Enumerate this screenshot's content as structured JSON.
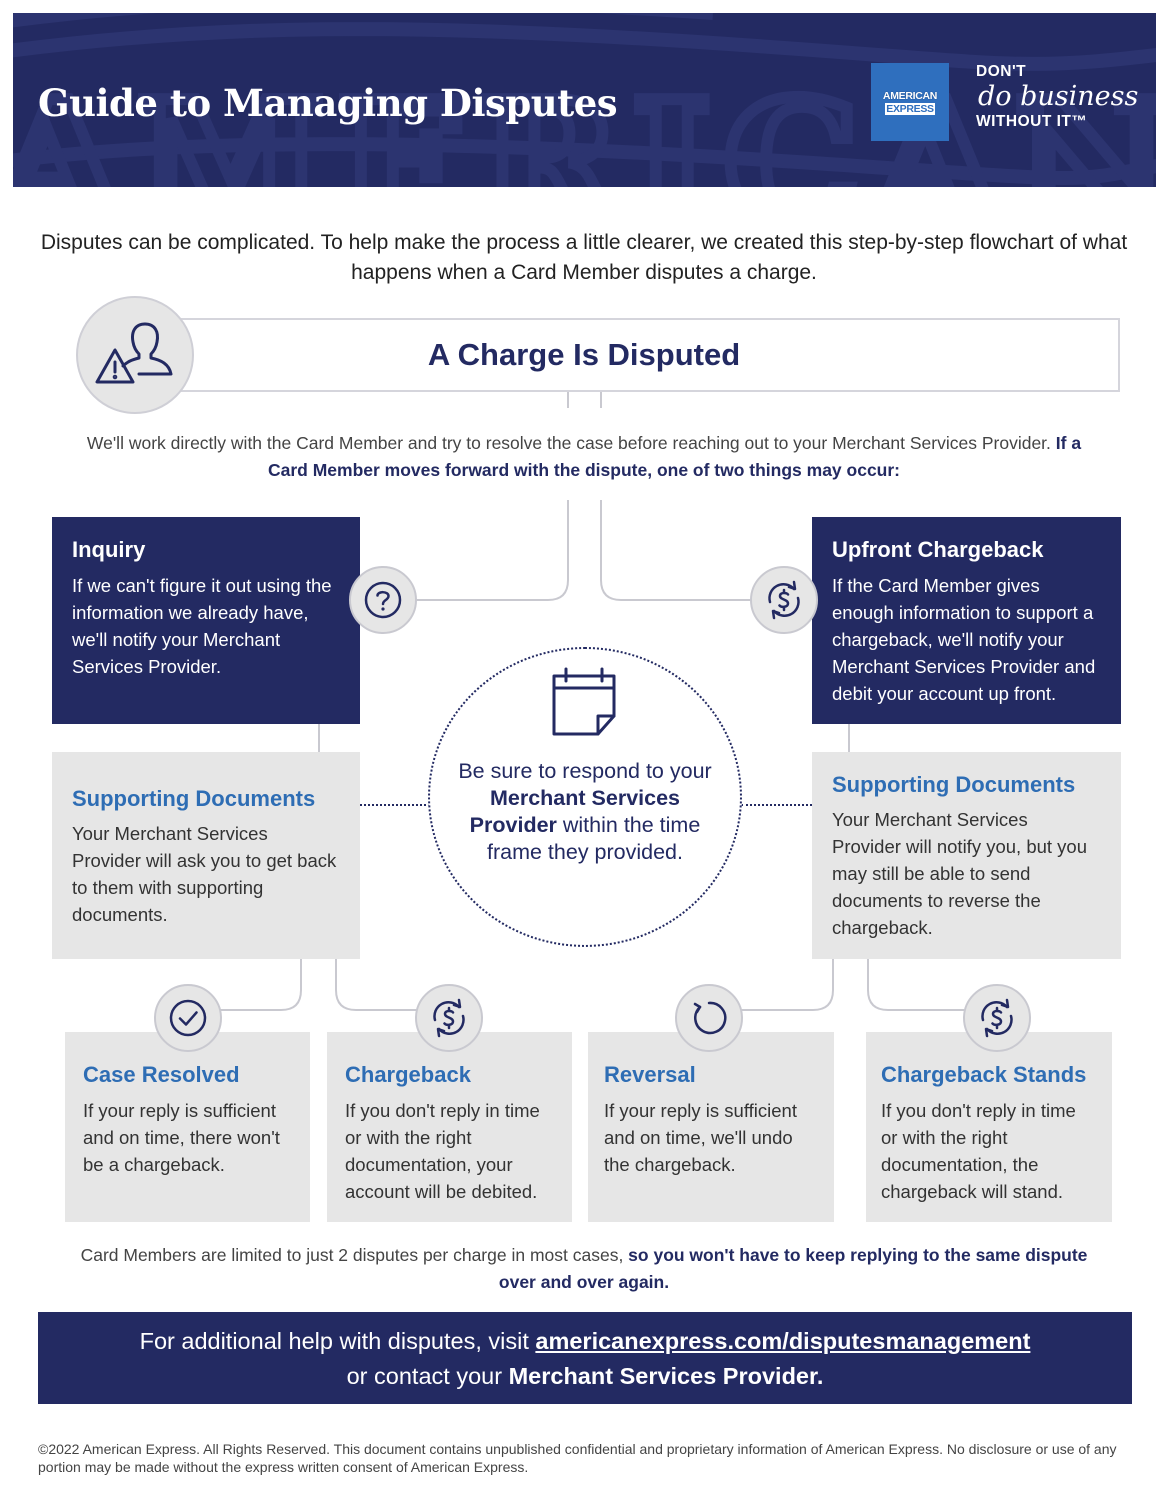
{
  "header": {
    "title": "Guide to Managing Disputes",
    "watermark_text": "AMERICAN EXPRESS",
    "logo": {
      "line1": "AMERICAN",
      "line2": "EXPRESS"
    },
    "tagline": {
      "line1": "DON'T",
      "line2": "do business",
      "line3": "WITHOUT IT™"
    },
    "colors": {
      "navy": "#232a62",
      "amex_blue": "#2f6fbe"
    }
  },
  "intro": "Disputes can be complicated. To help make the process a little clearer, we created this step-by-step flowchart of what happens when a Card Member disputes a charge.",
  "start": {
    "icon": "person-warning-icon",
    "title": "A Charge Is Disputed",
    "desc_plain": "We'll work directly with the Card Member and try to resolve the case before reaching out to your Merchant Services Provider.",
    "desc_bold": "If a Card Member moves forward with the dispute, one of two things may occur:"
  },
  "branches": {
    "inquiry": {
      "icon": "question-icon",
      "title": "Inquiry",
      "text": "If we can't figure it out using the information we already have, we'll notify your Merchant Services Provider."
    },
    "upfront": {
      "icon": "dollar-cycle-icon",
      "title": "Upfront Chargeback",
      "text": "If the Card Member gives enough information to support a chargeback, we'll notify your Merchant Services Provider and debit your account up front."
    }
  },
  "supporting": {
    "left": {
      "title": "Supporting Documents",
      "text": "Your Merchant Services Provider will ask you to get back to them with supporting documents."
    },
    "right": {
      "title": "Supporting Documents",
      "text": "Your Merchant Services Provider will notify you, but you may still be able to send documents to reverse the chargeback."
    }
  },
  "center": {
    "icon": "calendar-icon",
    "text_a": "Be sure to respond to your ",
    "text_b": "Merchant Services Provider",
    "text_c": " within the time frame they provided."
  },
  "outcomes": [
    {
      "icon": "checkmark-icon",
      "title": "Case Resolved",
      "text": "If your reply is sufficient and on time, there won't be a chargeback."
    },
    {
      "icon": "dollar-cycle-icon",
      "title": "Chargeback",
      "text": "If you don't reply in time or with the right documentation, your account will be debited."
    },
    {
      "icon": "undo-icon",
      "title": "Reversal",
      "text": "If your reply is sufficient and on time, we'll undo the chargeback."
    },
    {
      "icon": "dollar-cycle-icon",
      "title": "Chargeback Stands",
      "text": "If you don't reply in time or with the right documentation, the chargeback will stand."
    }
  ],
  "limit": {
    "plain": "Card Members are limited to just 2 disputes per charge in most cases, ",
    "bold": "so you won't have to keep replying to the same dispute over and over again."
  },
  "footer": {
    "line1_prefix": "For additional help with disputes, visit ",
    "link": "americanexpress.com/disputesmanagement",
    "line2_prefix": "or contact your ",
    "line2_bold": "Merchant Services Provider."
  },
  "copyright": "©2022 American Express. All Rights Reserved. This document contains unpublished confidential and proprietary information of American Express. No disclosure or use of any portion may be made without the express written consent of American Express."
}
